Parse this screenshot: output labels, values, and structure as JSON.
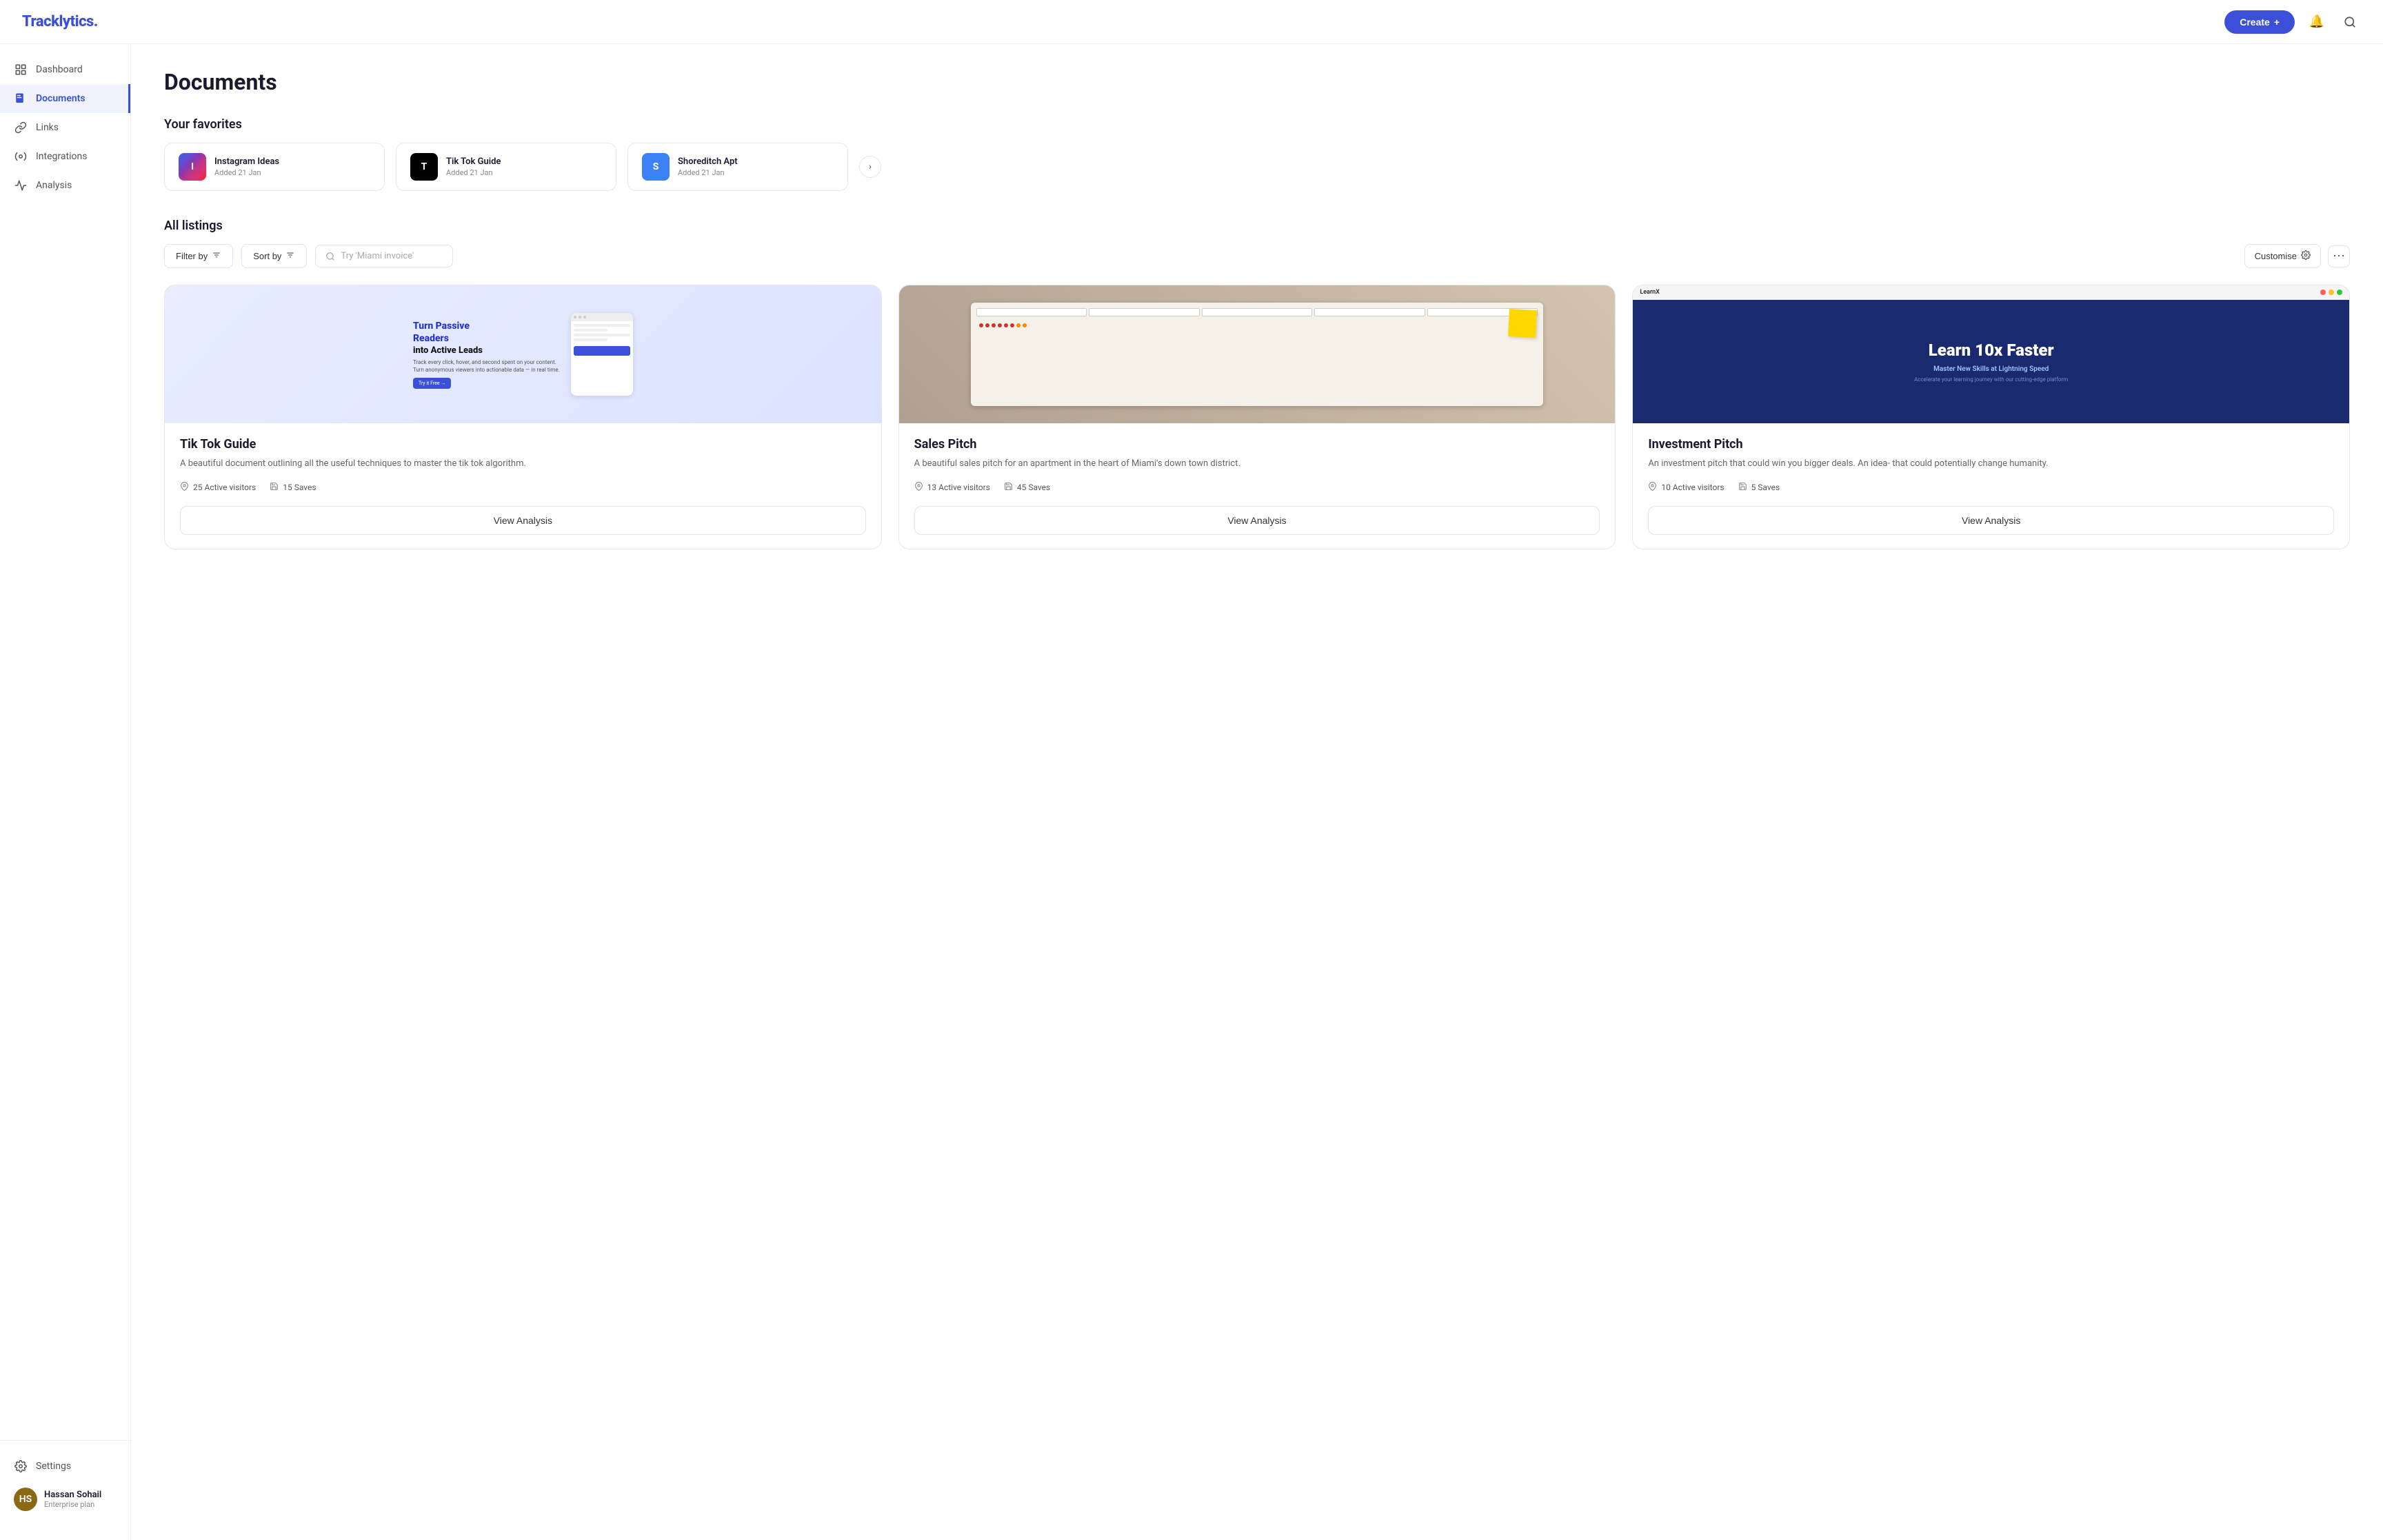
{
  "app": {
    "name": "Tracklytics",
    "name_suffix": "."
  },
  "topbar": {
    "create_label": "Create",
    "create_icon": "+",
    "notification_icon": "🔔",
    "search_icon": "🔍"
  },
  "sidebar": {
    "items": [
      {
        "id": "dashboard",
        "label": "Dashboard",
        "icon": "grid"
      },
      {
        "id": "documents",
        "label": "Documents",
        "icon": "doc",
        "active": true
      },
      {
        "id": "links",
        "label": "Links",
        "icon": "link"
      },
      {
        "id": "integrations",
        "label": "Integrations",
        "icon": "puzzle"
      },
      {
        "id": "analysis",
        "label": "Analysis",
        "icon": "chart"
      }
    ],
    "settings_label": "Settings",
    "user": {
      "name": "Hassan Sohail",
      "plan": "Enterprise plan",
      "initials": "HS"
    }
  },
  "page": {
    "title": "Documents",
    "favorites_section": "Your favorites",
    "listings_section": "All listings"
  },
  "favorites": [
    {
      "id": "insta",
      "name": "Instagram Ideas",
      "date": "Added 21 Jan",
      "color": "#e1306c",
      "initial": "I"
    },
    {
      "id": "tiktok",
      "name": "Tik Tok Guide",
      "date": "Added 21 Jan",
      "color": "#010101",
      "initial": "T"
    },
    {
      "id": "shore",
      "name": "Shoreditch Apt",
      "date": "Added 21 Jan",
      "color": "#3b82f6",
      "initial": "S"
    }
  ],
  "filters": {
    "filter_by": "Filter by",
    "sort_by": "Sort by",
    "search_placeholder": "Try 'Miami invoice'",
    "customise_label": "Customise"
  },
  "documents": [
    {
      "id": "tiktok-guide",
      "title": "Tik Tok Guide",
      "description": "A beautiful document outlining all the useful techniques to master the tik tok algorithm.",
      "active_visitors": "25 Active visitors",
      "saves": "15 Saves",
      "view_analysis": "View Analysis",
      "preview_type": "tiktok",
      "preview": {
        "headline1": "Turn Passive Readers",
        "headline2": "into Active Leads",
        "sub": "Track every click, hover, and second spent on your content. Turn anonymous viewers into actionable data — in real time.",
        "cta": "Try it Free →"
      }
    },
    {
      "id": "sales-pitch",
      "title": "Sales Pitch",
      "description": "A beautiful sales pitch for an apartment in the heart of Miami's down town district.",
      "active_visitors": "13 Active visitors",
      "saves": "45 Saves",
      "view_analysis": "View Analysis",
      "preview_type": "sales"
    },
    {
      "id": "investment-pitch",
      "title": "Investment Pitch",
      "description": "An investment pitch that could win you bigger deals. An idea- that could potentially change humanity.",
      "active_visitors": "10 Active visitors",
      "saves": "5 Saves",
      "view_analysis": "View Analysis",
      "preview_type": "invest",
      "preview": {
        "brand": "LearnX",
        "headline": "Learn 10x Faster",
        "sub": "Master New Skills at Lightning Speed",
        "desc": "Accelerate your learning journey with our cutting-edge platform"
      }
    }
  ]
}
